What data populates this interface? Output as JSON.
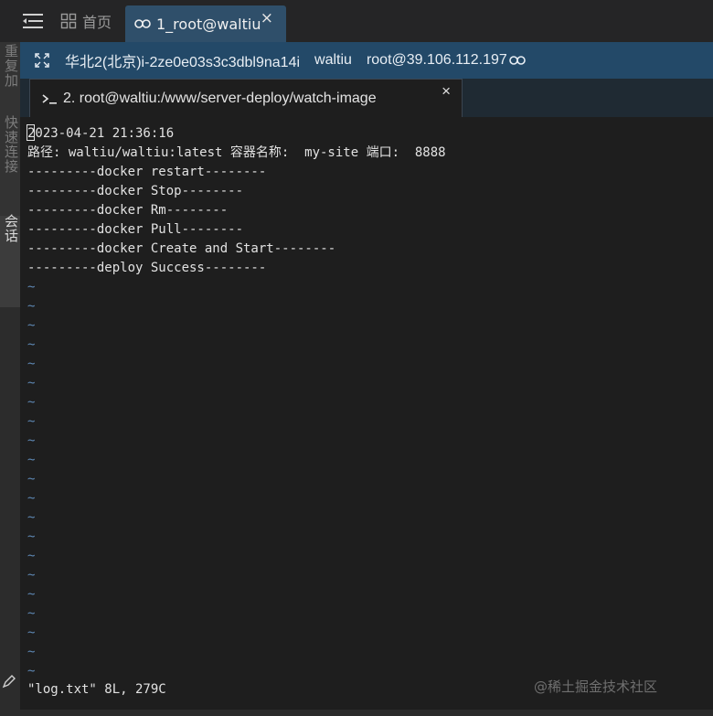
{
  "tabs": {
    "home_label": "首页",
    "active_label": "1_root@waltiu",
    "close_glyph": "×"
  },
  "session": {
    "region": "华北2(北京)i-2ze0e03s3c3dbl9na14i",
    "user": "waltiu",
    "host": "root@39.106.112.197"
  },
  "subtab": {
    "label": "2. root@waltiu:/www/server-deploy/watch-image",
    "close_glyph": "×"
  },
  "left_strip": {
    "text1": "重复加",
    "text2": "快速连接",
    "text3": "会话"
  },
  "terminal": {
    "lines": [
      "2023-04-21 21:36:16",
      "路径: waltiu/waltiu:latest 容器名称:  my-site 端口:  8888",
      "---------docker restart--------",
      "---------docker Stop--------",
      "---------docker Rm--------",
      "---------docker Pull--------",
      "---------docker Create and Start--------",
      "---------deploy Success--------"
    ],
    "tilde": "~",
    "status": "\"log.txt\" 8L, 279C"
  },
  "watermark": "@稀土掘金技术社区",
  "icons": {
    "menu": "menu-icon",
    "home": "grid-icon",
    "link": "link-icon",
    "expand": "expand-icon",
    "prompt": "terminal-prompt-icon",
    "pen": "pen-icon"
  },
  "colors": {
    "active_tab": "#2f4f6a",
    "info_bar": "#234968",
    "tilde": "#5d87b3"
  }
}
